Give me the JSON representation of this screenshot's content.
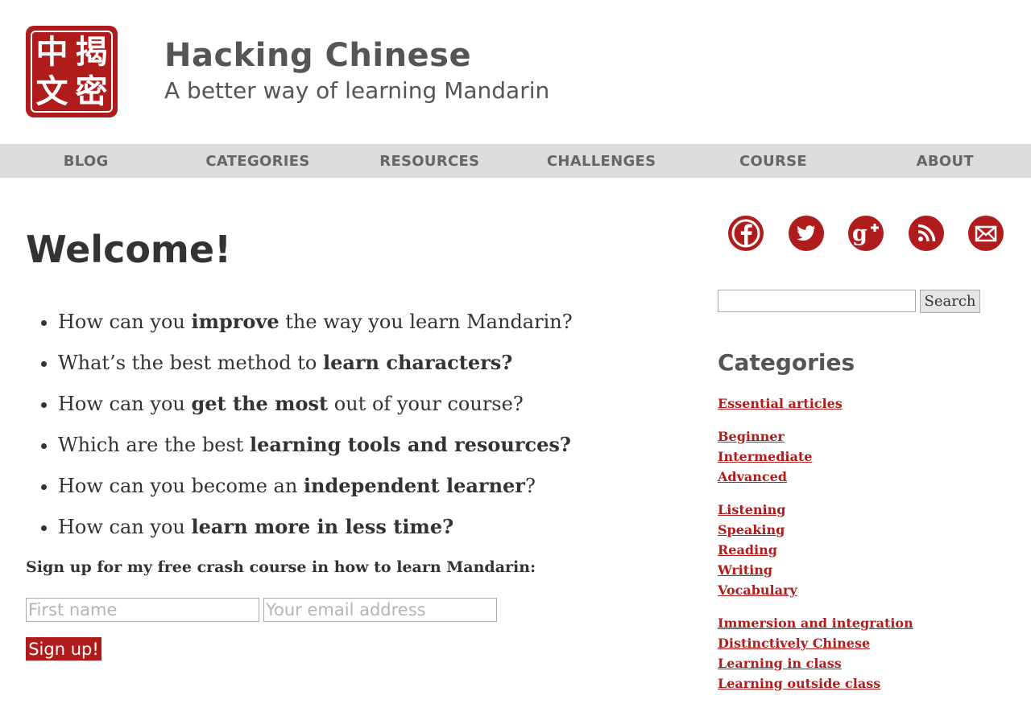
{
  "header": {
    "logo_chars": [
      "中",
      "揭",
      "文",
      "密"
    ],
    "title": "Hacking Chinese",
    "tagline": "A better way of learning Mandarin"
  },
  "nav": {
    "items": [
      "BLOG",
      "CATEGORIES",
      "RESOURCES",
      "CHALLENGES",
      "COURSE",
      "ABOUT"
    ]
  },
  "main": {
    "heading": "Welcome!",
    "questions": [
      {
        "pre": "How can you ",
        "bold": "improve",
        "post": " the way you learn Mandarin?"
      },
      {
        "pre": "What’s the best method to ",
        "bold": "learn characters?",
        "post": ""
      },
      {
        "pre": "How can you ",
        "bold": "get the most",
        "post": " out of your course?"
      },
      {
        "pre": "Which are the best ",
        "bold": "learning tools and resources?",
        "post": ""
      },
      {
        "pre": "How can you become an ",
        "bold": "independent learner",
        "post": "?"
      },
      {
        "pre": "How can you ",
        "bold": "learn more in less time?",
        "post": ""
      }
    ],
    "signup": {
      "text": "Sign up for my free crash course in how to learn Mandarin:",
      "first_name_placeholder": "First name",
      "email_placeholder": "Your email address",
      "button_label": "Sign up!"
    }
  },
  "sidebar": {
    "social_icons": [
      "facebook-icon",
      "twitter-icon",
      "google-plus-icon",
      "rss-icon",
      "email-icon"
    ],
    "search": {
      "input_value": "",
      "button_label": "Search"
    },
    "categories_heading": "Categories",
    "categories": [
      "Essential articles",
      "Beginner",
      "Intermediate",
      "Advanced",
      "Listening",
      "Speaking",
      "Reading",
      "Writing",
      "Vocabulary",
      "Immersion and integration",
      "Distinctively Chinese",
      "Learning in class",
      "Learning outside class"
    ]
  },
  "colors": {
    "accent": "#b01c1c",
    "nav_bg": "#dddddd",
    "nav_text": "#666666",
    "text": "#333333"
  }
}
